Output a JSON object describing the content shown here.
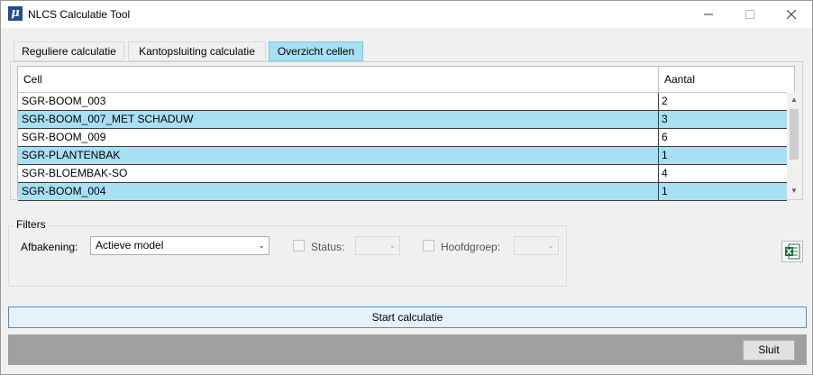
{
  "window": {
    "title": "NLCS Calculatie Tool",
    "app_icon_glyph": "μ",
    "icons": {
      "app": "nlcs-app-icon",
      "minimize": "minimize-icon",
      "maximize": "maximize-icon",
      "close": "close-icon"
    }
  },
  "tabs": [
    {
      "label": "Reguliere calculatie",
      "active": false
    },
    {
      "label": "Kantopsluiting calculatie",
      "active": false
    },
    {
      "label": "Overzicht cellen",
      "active": true
    }
  ],
  "grid": {
    "columns": [
      "Cell",
      "Aantal"
    ],
    "rows": [
      {
        "cell": "SGR-BOOM_003",
        "aantal": "2"
      },
      {
        "cell": "SGR-BOOM_007_MET SCHADUW",
        "aantal": "3"
      },
      {
        "cell": "SGR-BOOM_009",
        "aantal": "6"
      },
      {
        "cell": "SGR-PLANTENBAK",
        "aantal": "1"
      },
      {
        "cell": "SGR-BLOEMBAK-SO",
        "aantal": "4"
      },
      {
        "cell": "SGR-BOOM_004",
        "aantal": "1"
      }
    ]
  },
  "filters": {
    "legend": "Filters",
    "afbakening_label": "Afbakening:",
    "afbakening_value": "Actieve model",
    "status_label": "Status:",
    "status_value": "",
    "hoofdgroep_label": "Hoofdgroep:",
    "hoofdgroep_value": ""
  },
  "export_icon": "excel-icon",
  "colors": {
    "selected_tab": "#a7dff3",
    "alt_row": "#a7dff3",
    "primary_button_border": "#4a8fd6",
    "footer": "#a0a0a0"
  },
  "buttons": {
    "start": "Start calculatie",
    "close": "Sluit"
  }
}
